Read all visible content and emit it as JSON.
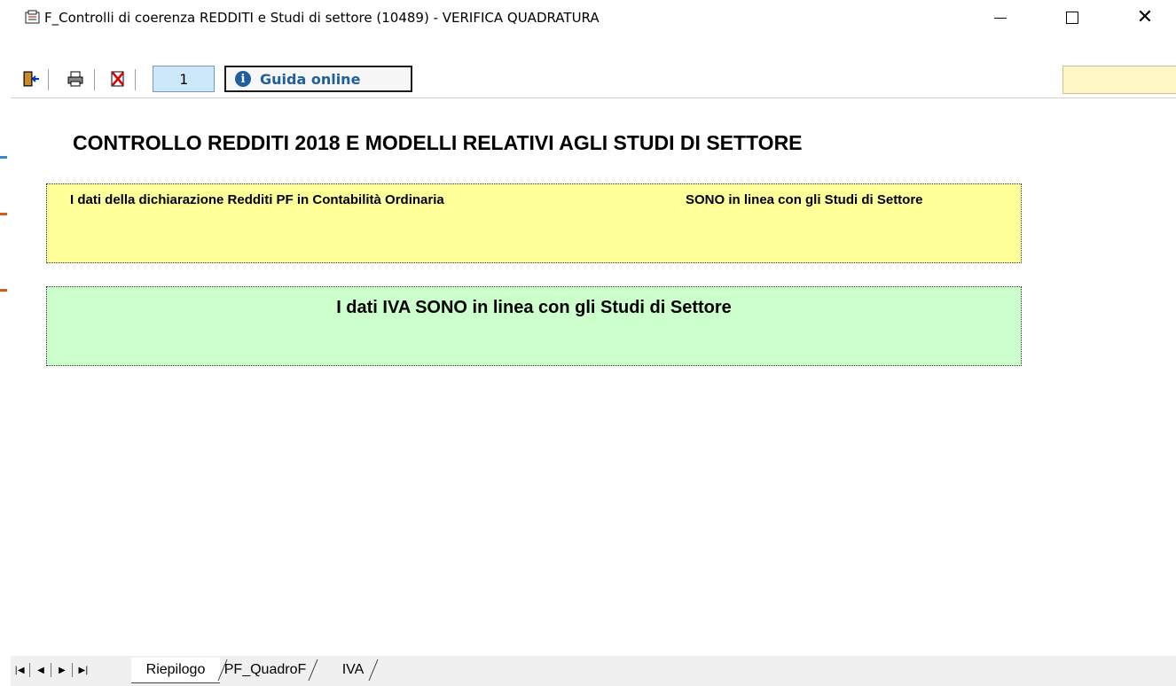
{
  "window": {
    "title": "F_Controlli di coerenza REDDITI e Studi di settore (10489) - VERIFICA QUADRATURA"
  },
  "toolbar": {
    "page_number": "1",
    "guide_label": "Guida online"
  },
  "content": {
    "heading": "CONTROLLO REDDITI 2018 E MODELLI RELATIVI AGLI STUDI DI SETTORE",
    "redditi_left": "I dati della dichiarazione Redditi PF in Contabilità Ordinaria",
    "redditi_right": "SONO in linea con gli Studi di Settore",
    "iva_message": "I dati IVA SONO in linea con gli Studi di Settore"
  },
  "sheet_tabs": [
    "Riepilogo",
    "PF_QuadroF",
    "IVA"
  ],
  "colors": {
    "yellow_panel": "#ffff99",
    "green_panel": "#ccffcc",
    "page_field": "#cde8fb",
    "guide_text": "#1f5fa0"
  }
}
